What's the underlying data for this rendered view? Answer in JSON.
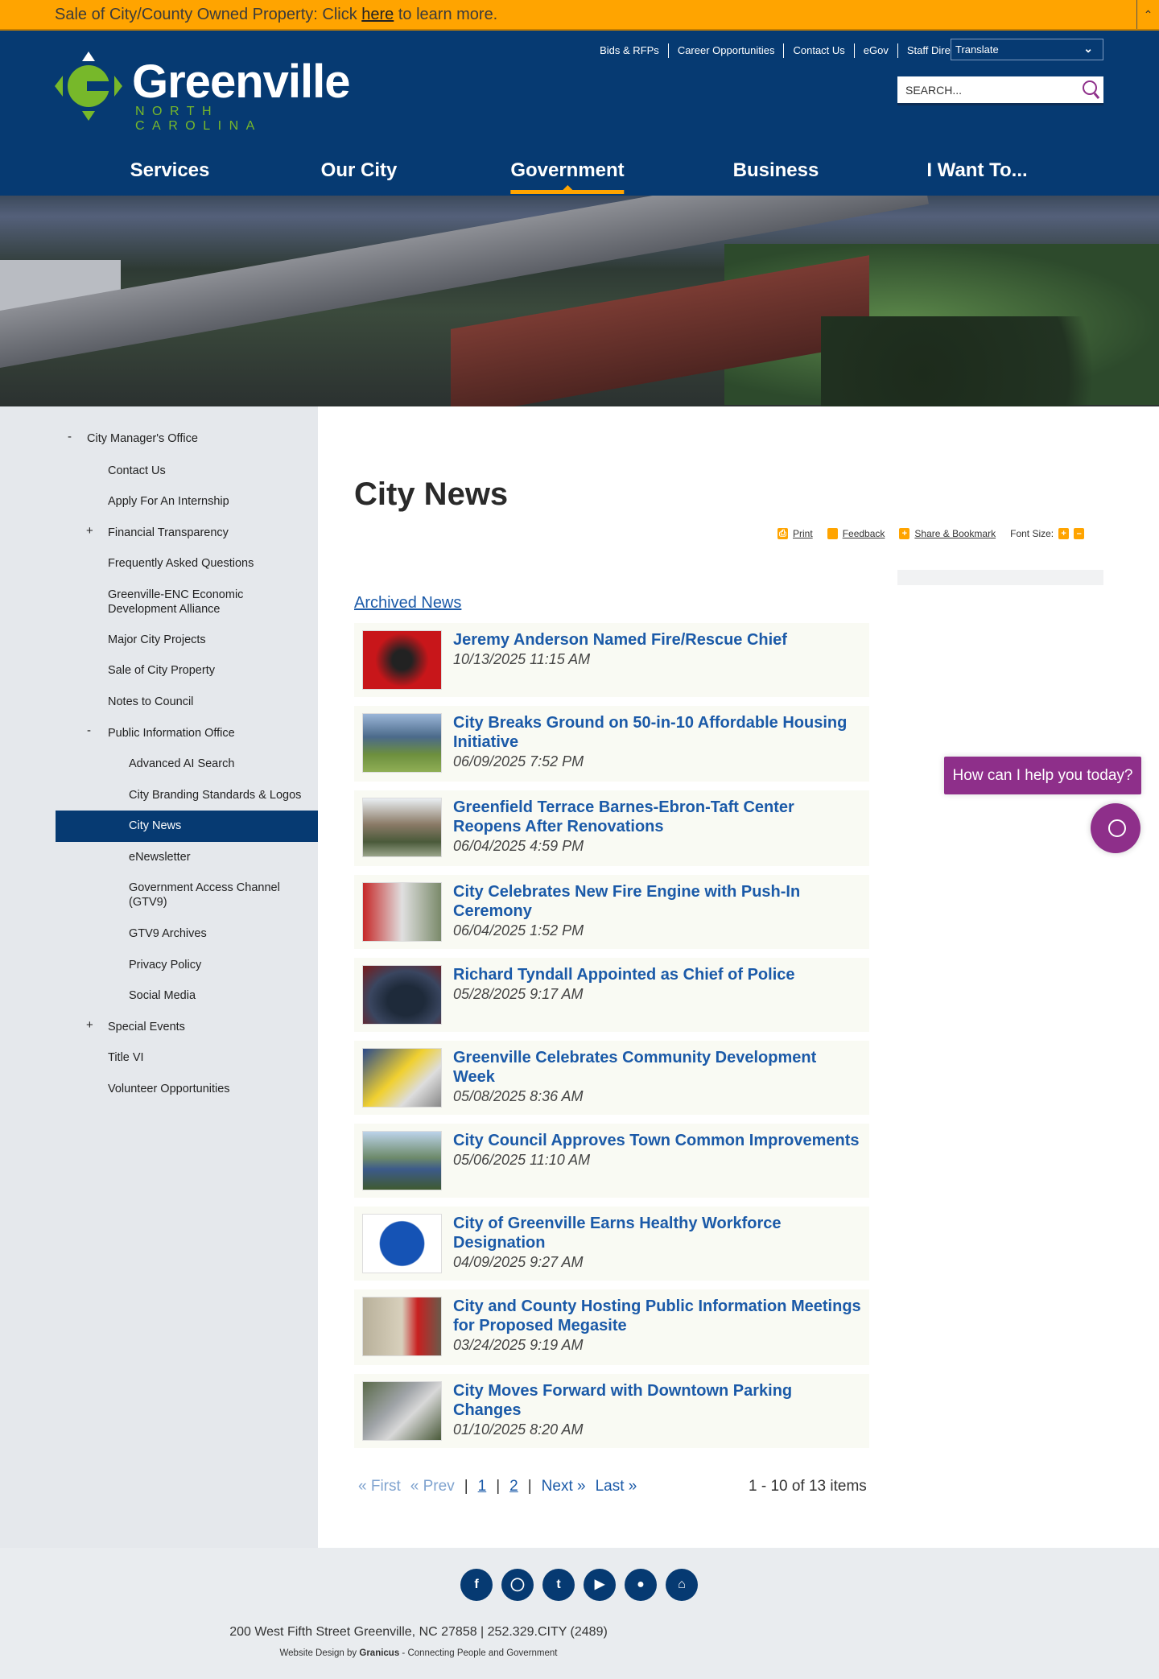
{
  "alert": {
    "text_before": "Sale of City/County Owned Property: Click ",
    "link": "here",
    "text_after": " to learn more.",
    "collapse_icon": "chevron-up-icon"
  },
  "header": {
    "utility_links": [
      "Bids & RFPs",
      "Career Opportunities",
      "Contact Us",
      "eGov",
      "Staff Directory"
    ],
    "translate": "Translate",
    "search_placeholder": "SEARCH...",
    "logo": {
      "name": "Greenville",
      "sub": "NORTH CAROLINA"
    },
    "nav": [
      "Services",
      "Our City",
      "Government",
      "Business",
      "I Want To..."
    ],
    "active_nav": "Government"
  },
  "sidebar": {
    "items": [
      "City Manager's Office",
      "Contact Us",
      "Apply For An Internship",
      "Financial Transparency",
      "Frequently Asked Questions",
      "Greenville-ENC Economic Development Alliance",
      "Major City Projects",
      "Sale of City Property",
      "Notes to Council",
      "Public Information Office",
      "Advanced AI Search",
      "City Branding Standards & Logos",
      "City News",
      "eNewsletter",
      "Government Access Channel (GTV9)",
      "GTV9 Archives",
      "Privacy Policy",
      "Social Media",
      "Special Events",
      "Title VI",
      "Volunteer Opportunities"
    ],
    "toggles": {
      "collapse": "-",
      "expand": "+"
    },
    "active": "City News"
  },
  "main": {
    "title": "City News",
    "tools": {
      "print": "Print",
      "feedback": "Feedback",
      "share": "Share & Bookmark",
      "font_size": "Font Size:"
    },
    "archived": "Archived News",
    "news": [
      {
        "title": "Jeremy Anderson Named Fire/Rescue Chief",
        "date": "10/13/2025 11:15 AM"
      },
      {
        "title": "City Breaks Ground on 50-in-10 Affordable Housing Initiative",
        "date": "06/09/2025 7:52 PM"
      },
      {
        "title": "Greenfield Terrace Barnes-Ebron-Taft Center Reopens After Renovations",
        "date": "06/04/2025 4:59 PM"
      },
      {
        "title": "City Celebrates New Fire Engine with Push-In Ceremony",
        "date": "06/04/2025 1:52 PM"
      },
      {
        "title": "Richard Tyndall Appointed as Chief of Police",
        "date": "05/28/2025 9:17 AM"
      },
      {
        "title": "Greenville Celebrates Community Development Week",
        "date": "05/08/2025 8:36 AM"
      },
      {
        "title": "City Council Approves Town Common Improvements",
        "date": "05/06/2025 11:10 AM"
      },
      {
        "title": "City of Greenville Earns Healthy Workforce Designation",
        "date": "04/09/2025 9:27 AM"
      },
      {
        "title": "City and County Hosting Public Information Meetings for Proposed Megasite",
        "date": "03/24/2025 9:19 AM"
      },
      {
        "title": "City Moves Forward with Downtown Parking Changes",
        "date": "01/10/2025 8:20 AM"
      }
    ],
    "pager": {
      "first": "« First",
      "prev": "« Prev",
      "sep": "|",
      "pages": [
        "1",
        "2"
      ],
      "next": "Next »",
      "last": "Last »",
      "count": "1 - 10 of 13 items"
    }
  },
  "footer": {
    "social": [
      "facebook",
      "instagram",
      "twitter",
      "youtube",
      "snapchat",
      "nextdoor"
    ],
    "address": "200 West Fifth Street Greenville, NC 27858 | 252.329.CITY (2489)",
    "credit_prefix": "Website Design by ",
    "credit_brand": "Granicus",
    "credit_suffix": " - Connecting People and Government"
  },
  "chat": {
    "prompt": "How can I help you today?"
  },
  "colors": {
    "brand": "#063a72",
    "accent": "#ffa400",
    "link": "#1b5aa8",
    "chat": "#8e2f8a",
    "logo_green": "#77b82a"
  }
}
